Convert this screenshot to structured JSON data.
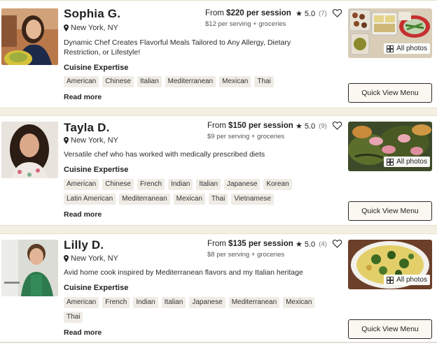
{
  "chefs": [
    {
      "name": "Sophia G.",
      "location": "New York, NY",
      "price_from": "From",
      "price_value": "$220 per session",
      "serving": "$12 per serving + groceries",
      "rating": "5.0",
      "reviews": "(7)",
      "description": "Dynamic Chef Creates Flavorful Meals Tailored to Any Allergy, Dietary Restriction, or Lifestyle!",
      "expertise_label": "Cuisine Expertise",
      "cuisines": [
        "American",
        "Chinese",
        "Italian",
        "Mediterranean",
        "Mexican",
        "Thai"
      ],
      "read_more": "Read more",
      "all_photos": "All photos",
      "quick_view": "Quick View Menu"
    },
    {
      "name": "Tayla D.",
      "location": "New York, NY",
      "price_from": "From",
      "price_value": "$150 per session",
      "serving": "$9 per serving + groceries",
      "rating": "5.0",
      "reviews": "(9)",
      "description": "Versatile chef who has worked with medically prescribed diets",
      "expertise_label": "Cuisine Expertise",
      "cuisines": [
        "American",
        "Chinese",
        "French",
        "Indian",
        "Italian",
        "Japanese",
        "Korean",
        "Latin American",
        "Mediterranean",
        "Mexican",
        "Thai",
        "Vietnamese"
      ],
      "read_more": "Read more",
      "all_photos": "All photos",
      "quick_view": "Quick View Menu"
    },
    {
      "name": "Lilly D.",
      "location": "New York, NY",
      "price_from": "From",
      "price_value": "$135 per session",
      "serving": "$8 per serving + groceries",
      "rating": "5.0",
      "reviews": "(4)",
      "description": "Avid home cook inspired by Mediterranean flavors and my Italian heritage",
      "expertise_label": "Cuisine Expertise",
      "cuisines": [
        "American",
        "French",
        "Indian",
        "Italian",
        "Japanese",
        "Mediterranean",
        "Mexican",
        "Thai"
      ],
      "read_more": "Read more",
      "all_photos": "All photos",
      "quick_view": "Quick View Menu"
    }
  ],
  "icons": {
    "star": "star-icon",
    "heart": "heart-outline-icon",
    "pin": "location-pin-icon",
    "grid": "photo-grid-icon"
  },
  "colors": {
    "page_background": "#f3efe3",
    "card_background": "#ffffff",
    "tag_background": "#efece6",
    "button_background": "#faf8f0"
  }
}
